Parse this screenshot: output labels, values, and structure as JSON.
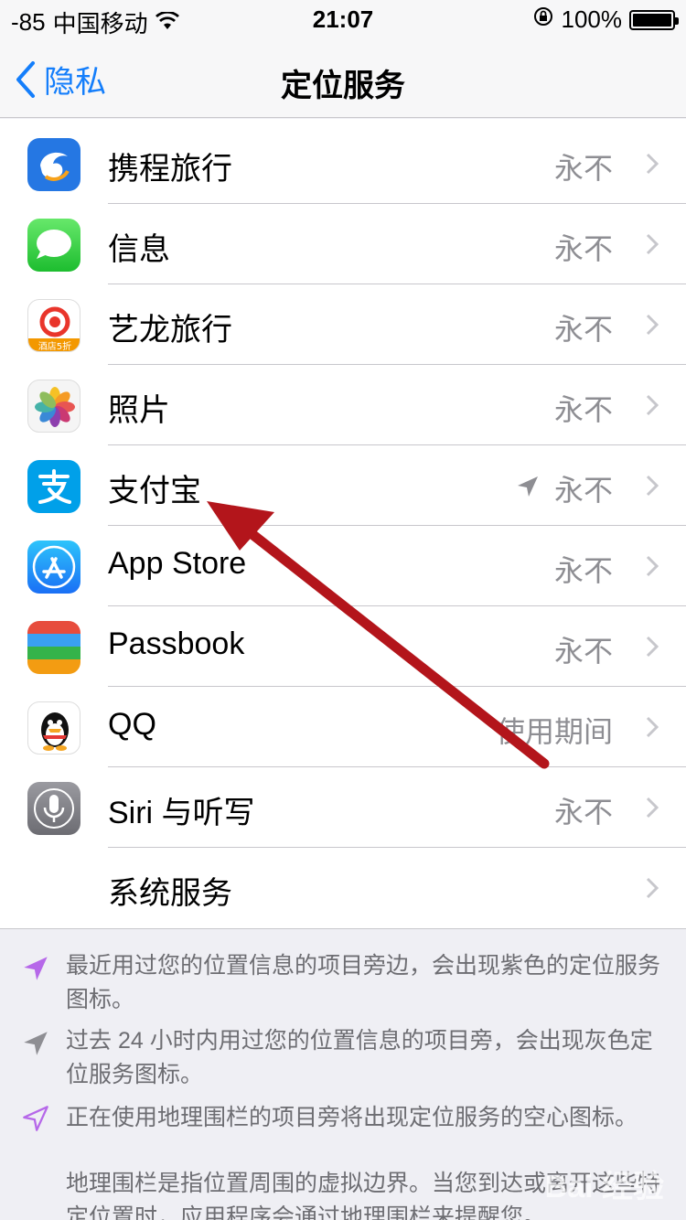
{
  "status": {
    "signal": "-85",
    "carrier": "中国移动",
    "time": "21:07",
    "battery": "100%"
  },
  "nav": {
    "back_label": "隐私",
    "title": "定位服务"
  },
  "apps": [
    {
      "label": "携程旅行",
      "value": "永不",
      "icon": "ctrip-icon",
      "color": "#2577e3"
    },
    {
      "label": "信息",
      "value": "永不",
      "icon": "messages-icon",
      "color": "#4cd964"
    },
    {
      "label": "艺龙旅行",
      "value": "永不",
      "icon": "elong-icon",
      "color": "#e9352b"
    },
    {
      "label": "照片",
      "value": "永不",
      "icon": "photos-icon",
      "color": "#f5f5f5"
    },
    {
      "label": "支付宝",
      "value": "永不",
      "icon": "alipay-icon",
      "color": "#00a0e9",
      "location_arrow": true
    },
    {
      "label": "App Store",
      "value": "永不",
      "icon": "app-store-icon",
      "color": "#1a8bf5"
    },
    {
      "label": "Passbook",
      "value": "永不",
      "icon": "passbook-icon",
      "color": "#35b34a"
    },
    {
      "label": "QQ",
      "value": "使用期间",
      "icon": "qq-icon",
      "color": "#ffffff"
    },
    {
      "label": "Siri 与听写",
      "value": "永不",
      "icon": "siri-icon",
      "color": "#8e8e93"
    },
    {
      "label": "系统服务",
      "value": "",
      "icon": "",
      "color": ""
    }
  ],
  "notes": [
    {
      "text": "最近用过您的位置信息的项目旁边，会出现紫色的定位服务图标。",
      "icon": "location-arrow-purple-icon",
      "color": "#b668e9"
    },
    {
      "text": "过去 24 小时内用过您的位置信息的项目旁，会出现灰色定位服务图标。",
      "icon": "location-arrow-gray-icon",
      "color": "#8e8e93"
    },
    {
      "text": "正在使用地理围栏的项目旁将出现定位服务的空心图标。",
      "icon": "location-arrow-outline-icon",
      "color": "#b668e9"
    },
    {
      "text": "地理围栏是指位置周围的虚拟边界。当您到达或离开这些特定位置时，应用程序会通过地理围栏来提醒您。",
      "icon": "",
      "color": ""
    }
  ],
  "watermark": "Bai 经验",
  "accent": "#147efb",
  "annotation_arrow_color": "#b3151b"
}
